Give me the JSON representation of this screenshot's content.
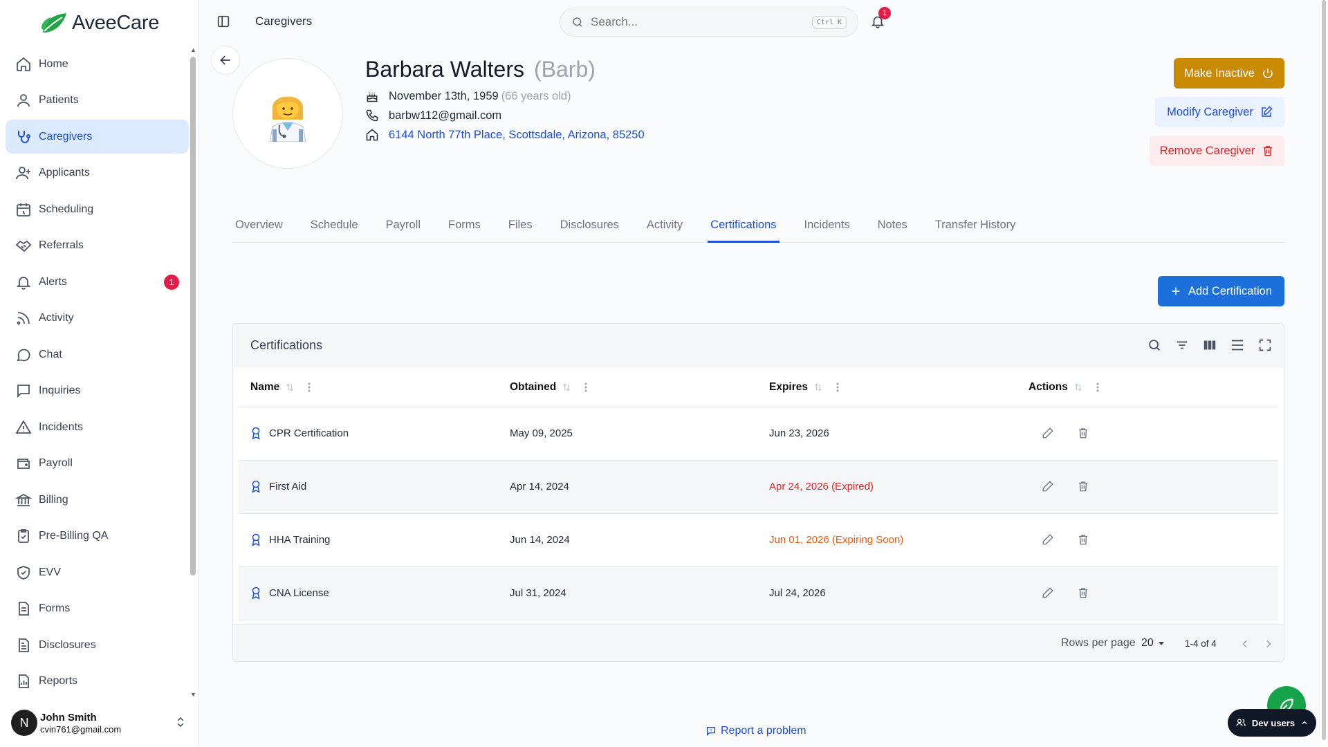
{
  "app": {
    "name": "AveeCare"
  },
  "sidebar": {
    "items": [
      {
        "label": "Home",
        "icon": "home-icon"
      },
      {
        "label": "Patients",
        "icon": "user-icon"
      },
      {
        "label": "Caregivers",
        "icon": "stethoscope-icon",
        "active": true
      },
      {
        "label": "Applicants",
        "icon": "user-plus-icon"
      },
      {
        "label": "Scheduling",
        "icon": "calendar-icon"
      },
      {
        "label": "Referrals",
        "icon": "handshake-icon"
      },
      {
        "label": "Alerts",
        "icon": "bell-icon",
        "badge": "1"
      },
      {
        "label": "Activity",
        "icon": "rss-icon"
      },
      {
        "label": "Chat",
        "icon": "chat-icon"
      },
      {
        "label": "Inquiries",
        "icon": "message-square-icon"
      },
      {
        "label": "Incidents",
        "icon": "warning-icon"
      },
      {
        "label": "Payroll",
        "icon": "wallet-icon"
      },
      {
        "label": "Billing",
        "icon": "bank-icon"
      },
      {
        "label": "Pre-Billing QA",
        "icon": "clipboard-check-icon"
      },
      {
        "label": "EVV",
        "icon": "shield-check-icon"
      },
      {
        "label": "Forms",
        "icon": "document-icon"
      },
      {
        "label": "Disclosures",
        "icon": "file-text-icon"
      },
      {
        "label": "Reports",
        "icon": "report-icon"
      }
    ],
    "user": {
      "initial": "N",
      "name": "John Smith",
      "email": "cvin761@gmail.com"
    }
  },
  "topbar": {
    "breadcrumb": "Caregivers",
    "search_placeholder": "Search...",
    "search_shortcut": "Ctrl K",
    "notification_count": "1"
  },
  "profile": {
    "name": "Barbara Walters",
    "nickname": "(Barb)",
    "birthdate": "November 13th, 1959",
    "age": "(66 years old)",
    "email": "barbw112@gmail.com",
    "address": "6144 North 77th Place, Scottsdale, Arizona, 85250"
  },
  "actions": {
    "make_inactive": "Make Inactive",
    "modify": "Modify Caregiver",
    "remove": "Remove Caregiver",
    "add_certification": "Add Certification"
  },
  "tabs": [
    {
      "label": "Overview"
    },
    {
      "label": "Schedule"
    },
    {
      "label": "Payroll"
    },
    {
      "label": "Forms"
    },
    {
      "label": "Files"
    },
    {
      "label": "Disclosures"
    },
    {
      "label": "Activity"
    },
    {
      "label": "Certifications",
      "active": true
    },
    {
      "label": "Incidents"
    },
    {
      "label": "Notes"
    },
    {
      "label": "Transfer History"
    }
  ],
  "table": {
    "title": "Certifications",
    "columns": [
      "Name",
      "Obtained",
      "Expires",
      "Actions"
    ],
    "rows": [
      {
        "name": "CPR Certification",
        "obtained": "May 09, 2025",
        "expires": "Jun 23, 2026",
        "status": "ok"
      },
      {
        "name": "First Aid",
        "obtained": "Apr 14, 2024",
        "expires": "Apr 24, 2026 (Expired)",
        "status": "expired"
      },
      {
        "name": "HHA Training",
        "obtained": "Jun 14, 2024",
        "expires": "Jun 01, 2026 (Expiring Soon)",
        "status": "soon"
      },
      {
        "name": "CNA License",
        "obtained": "Jul 31, 2024",
        "expires": "Jul 24, 2026",
        "status": "ok"
      }
    ],
    "rows_per_page_label": "Rows per page",
    "rows_per_page": "20",
    "range": "1-4 of 4"
  },
  "footer": {
    "report": "Report a problem",
    "dev_users": "Dev users"
  },
  "colors": {
    "primary": "#1d6fdb",
    "accent_warning": "#ca8a04",
    "danger": "#dc2626",
    "expiring": "#ea580c",
    "brand_green": "#16a34a"
  }
}
